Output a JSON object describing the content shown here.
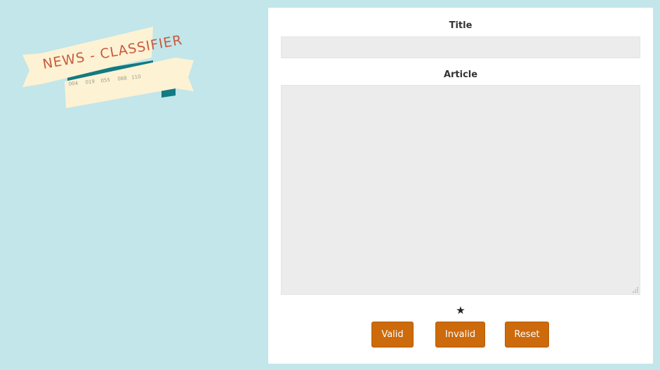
{
  "logo": {
    "text": "NEWS - CLASSIFIER",
    "ticks": [
      "004",
      "019",
      "055",
      "088",
      "110"
    ],
    "ribbon_color": "#fdf2d3",
    "fold_color": "#127a82",
    "text_color": "#c65a3f"
  },
  "form": {
    "title_label": "Title",
    "title_value": "",
    "article_label": "Article",
    "article_value": "",
    "star_glyph": "★",
    "buttons": {
      "valid": "Valid",
      "invalid": "Invalid",
      "reset": "Reset"
    }
  },
  "colors": {
    "background": "#c2e6e9",
    "panel": "#ffffff",
    "input_bg": "#ececec",
    "button": "#cc6a0c"
  }
}
